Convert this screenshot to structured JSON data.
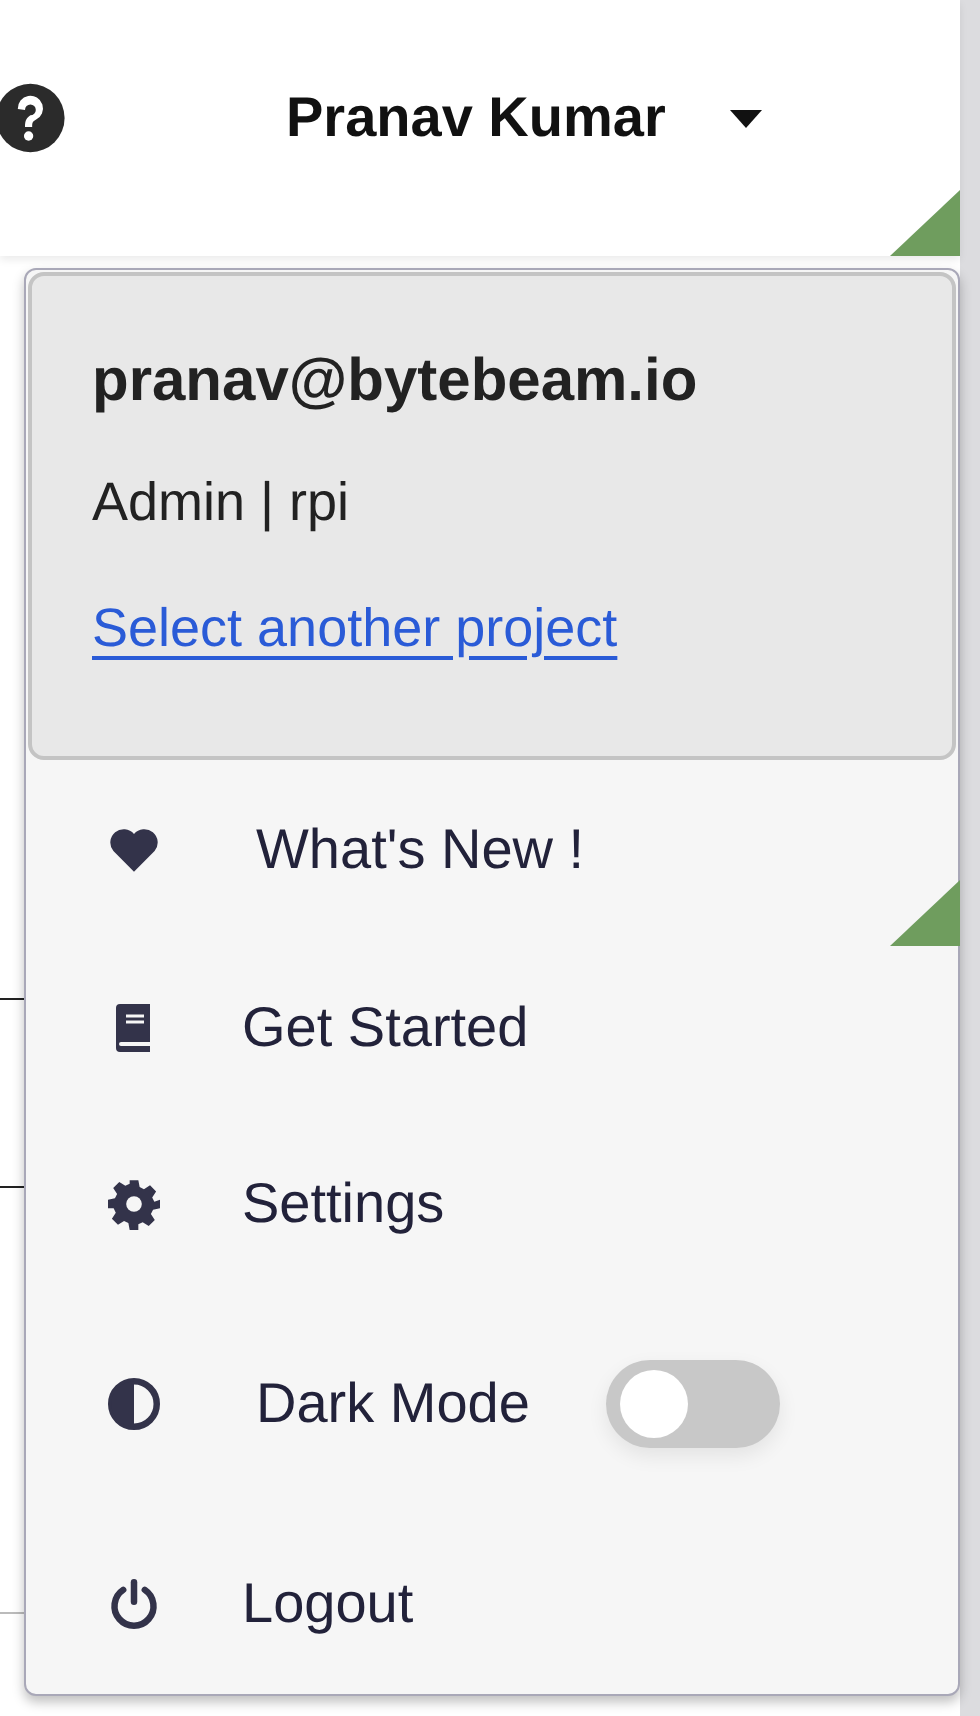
{
  "header": {
    "user_name": "Pranav Kumar"
  },
  "account": {
    "email": "pranav@bytebeam.io",
    "role_project": "Admin | rpi",
    "link": "Select another project"
  },
  "menu": [
    {
      "kind": "link",
      "label": "What's New !"
    },
    {
      "kind": "link",
      "label": "Get Started"
    },
    {
      "kind": "link",
      "label": "Settings"
    },
    {
      "kind": "toggle",
      "label": "Dark Mode",
      "on": false
    },
    {
      "kind": "link",
      "label": "Logout"
    }
  ]
}
